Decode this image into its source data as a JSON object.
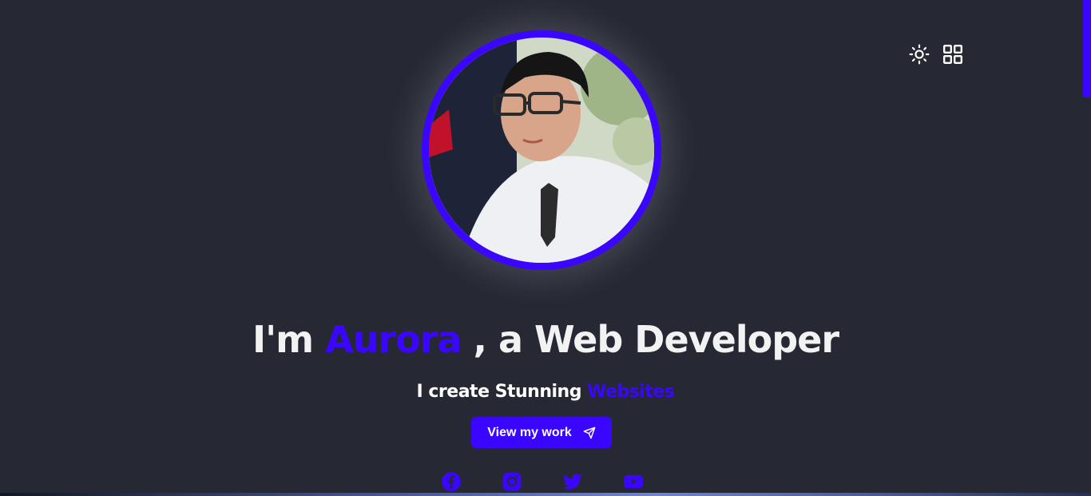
{
  "header": {
    "theme_toggle_icon": "sun-icon",
    "menu_icon": "grid-icon"
  },
  "hero": {
    "avatar_alt": "profile photo",
    "headline_prefix": "I'm",
    "name": "Aurora",
    "headline_suffix": ", a Web Developer",
    "subline_prefix": "I create Stunning",
    "subline_accent": "Websites",
    "cta_label": "View my work",
    "cta_icon": "send-icon"
  },
  "socials": [
    {
      "name": "facebook-icon"
    },
    {
      "name": "instagram-icon"
    },
    {
      "name": "twitter-icon"
    },
    {
      "name": "youtube-icon"
    }
  ],
  "colors": {
    "background": "#262933",
    "accent": "#3a06ff",
    "text": "#f2f2f2"
  }
}
